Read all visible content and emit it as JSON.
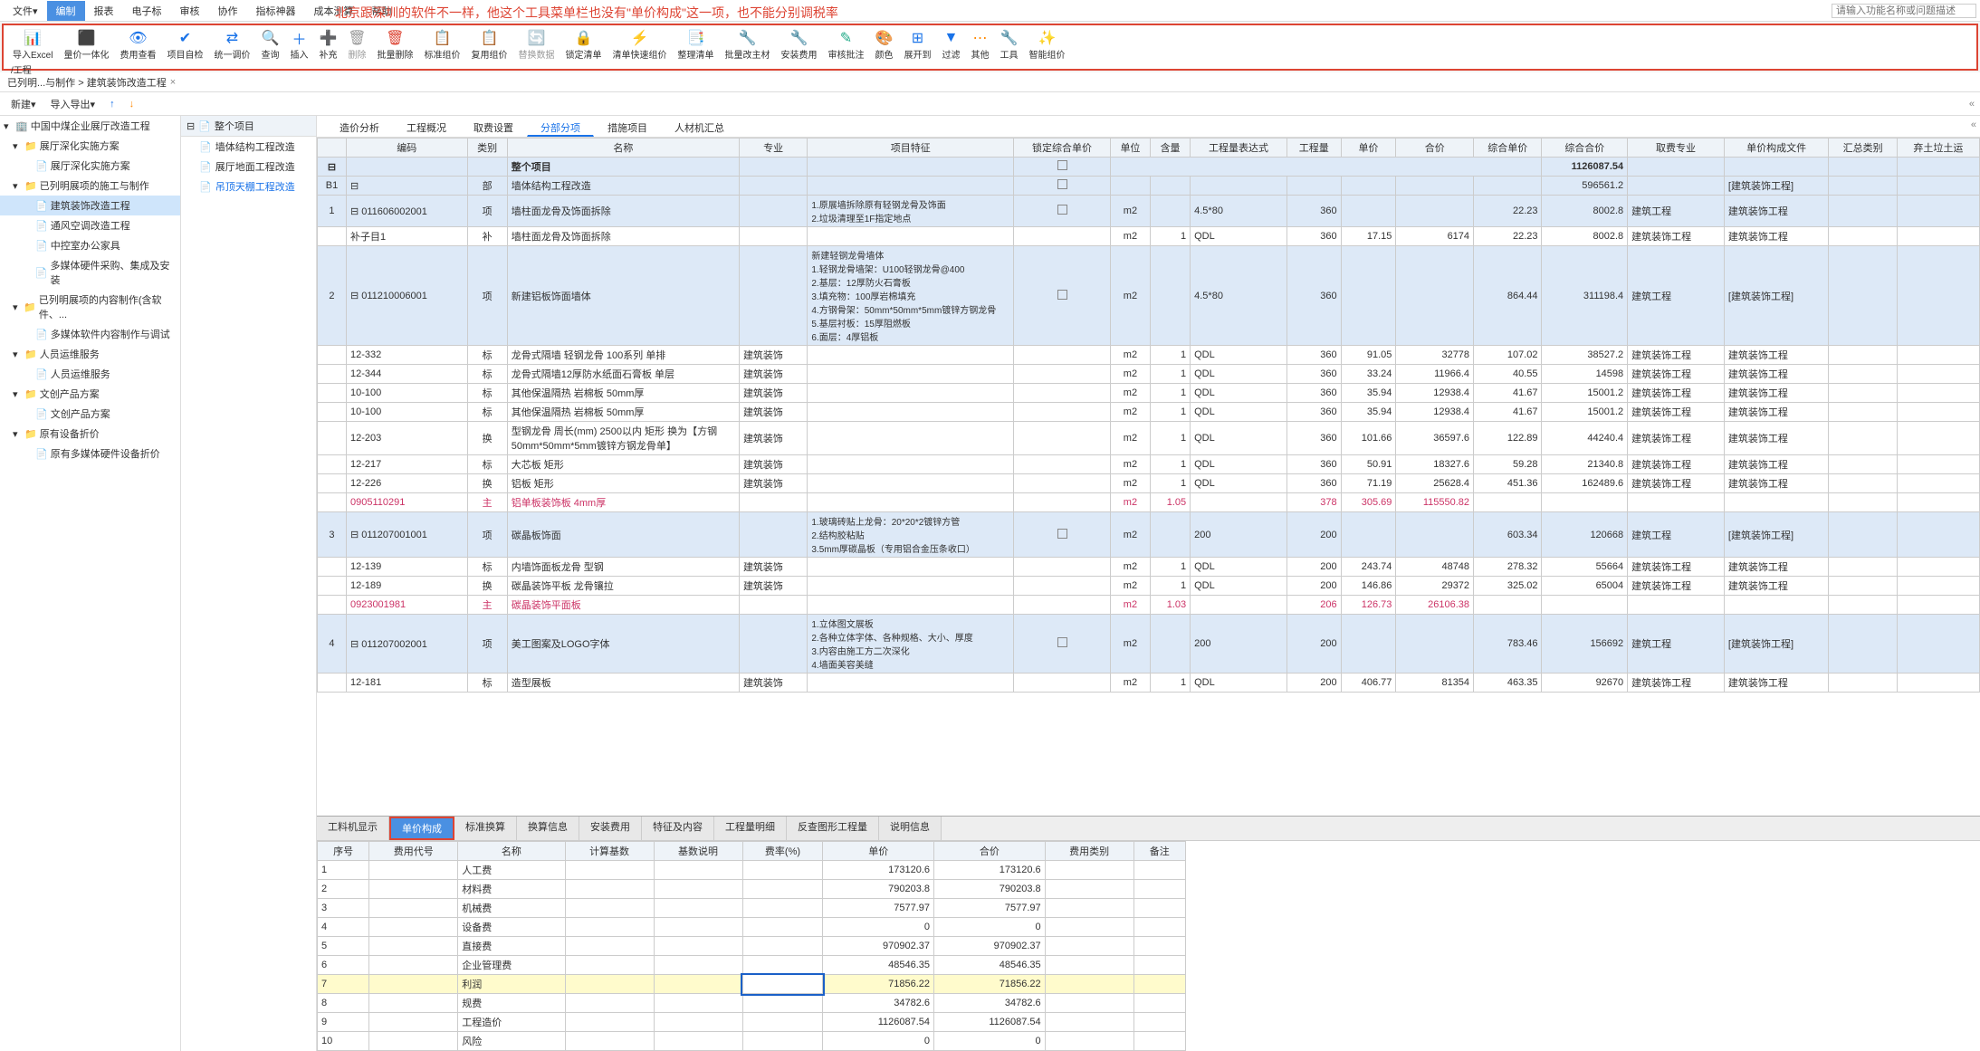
{
  "menu": {
    "items": [
      "文件▾",
      "编制",
      "报表",
      "电子标",
      "审核",
      "协作",
      "指标神器",
      "成本测算",
      "帮助"
    ],
    "active_index": 1,
    "search_placeholder": "请输入功能名称或问题描述"
  },
  "annotation": "北京跟深圳的软件不一样，他这个工具菜单栏也没有\"单价构成\"这一项，也不能分别调税率",
  "toolbar": {
    "items": [
      "导入Excel",
      "量价一体化",
      "费用查看",
      "项目自检",
      "统一调价",
      "查询",
      "插入",
      "补充",
      "删除",
      "批量删除",
      "标准组价",
      "复用组价",
      "替换数据",
      "锁定清单",
      "清单快速组价",
      "整理清单",
      "批量改主材",
      "安装费用",
      "审核批注",
      "颜色",
      "展开到",
      "过滤",
      "其他",
      "工具",
      "智能组价"
    ],
    "sub": "/工程"
  },
  "breadcrumb": {
    "path": "已列明...与制作 > 建筑装饰改造工程",
    "close": "×"
  },
  "doc_tabs": {
    "items": [
      "造价分析",
      "工程概况",
      "取费设置",
      "分部分项",
      "措施项目",
      "人材机汇总"
    ],
    "active_index": 3
  },
  "actions": {
    "new": "新建▾",
    "export": "导入导出▾"
  },
  "left_tree": {
    "root": "中国中煤企业展厅改造工程",
    "items": [
      {
        "t": "展厅深化实施方案",
        "lvl": 1,
        "caret": "▾"
      },
      {
        "t": "展厅深化实施方案",
        "lvl": 2,
        "caret": ""
      },
      {
        "t": "已列明展项的施工与制作",
        "lvl": 1,
        "caret": "▾"
      },
      {
        "t": "建筑装饰改造工程",
        "lvl": 2,
        "caret": "",
        "sel": true
      },
      {
        "t": "通风空调改造工程",
        "lvl": 2,
        "caret": ""
      },
      {
        "t": "中控室办公家具",
        "lvl": 2,
        "caret": ""
      },
      {
        "t": "多媒体硬件采购、集成及安装",
        "lvl": 2,
        "caret": ""
      },
      {
        "t": "已列明展项的内容制作(含软件、...",
        "lvl": 1,
        "caret": "▾"
      },
      {
        "t": "多媒体软件内容制作与调试",
        "lvl": 2,
        "caret": ""
      },
      {
        "t": "人员运维服务",
        "lvl": 1,
        "caret": "▾"
      },
      {
        "t": "人员运维服务",
        "lvl": 2,
        "caret": ""
      },
      {
        "t": "文创产品方案",
        "lvl": 1,
        "caret": "▾"
      },
      {
        "t": "文创产品方案",
        "lvl": 2,
        "caret": ""
      },
      {
        "t": "原有设备折价",
        "lvl": 1,
        "caret": "▾"
      },
      {
        "t": "原有多媒体硬件设备折价",
        "lvl": 2,
        "caret": ""
      }
    ]
  },
  "mid_tree": {
    "header": "整个项目",
    "items": [
      "墙体结构工程改造",
      "展厅地面工程改造",
      "吊顶天棚工程改造"
    ],
    "sel_index": 2
  },
  "grid": {
    "headers": [
      "",
      "编码",
      "类别",
      "名称",
      "专业",
      "项目特征",
      "锁定综合单价",
      "单位",
      "含量",
      "工程量表达式",
      "工程量",
      "单价",
      "合价",
      "综合单价",
      "综合合价",
      "取费专业",
      "单价构成文件",
      "汇总类别",
      "弃土垃土运"
    ],
    "total_label": "整个项目",
    "total_value": "1126087.54",
    "rows": [
      {
        "idx": "B1",
        "cls": "row-blue",
        "code": "",
        "cat": "部",
        "name": "墙体结构工程改造",
        "spec": "",
        "feat": "",
        "unit": "",
        "qty": "",
        "expr": "",
        "amt": "",
        "up": "",
        "hp": "",
        "cup": "",
        "chp": "596561.2",
        "fee": "",
        "file": "[建筑装饰工程]"
      },
      {
        "idx": "1",
        "cls": "row-blue",
        "code": "011606002001",
        "cat": "项",
        "name": "墙柱面龙骨及饰面拆除",
        "spec": "",
        "feat": "1.原展墙拆除原有轻钢龙骨及饰面\n2.垃圾清理至1F指定地点",
        "unit": "m2",
        "qty": "",
        "expr": "4.5*80",
        "amt": "360",
        "up": "",
        "hp": "",
        "cup": "22.23",
        "chp": "8002.8",
        "fee": "建筑工程",
        "file": "建筑装饰工程"
      },
      {
        "idx": "",
        "cls": "",
        "code": "补子目1",
        "cat": "补",
        "name": "墙柱面龙骨及饰面拆除",
        "spec": "",
        "feat": "",
        "unit": "m2",
        "qty": "1",
        "expr": "QDL",
        "amt": "360",
        "up": "17.15",
        "hp": "6174",
        "cup": "22.23",
        "chp": "8002.8",
        "fee": "建筑装饰工程",
        "file": "建筑装饰工程"
      },
      {
        "idx": "2",
        "cls": "row-blue",
        "code": "011210006001",
        "cat": "项",
        "name": "新建铝板饰面墙体",
        "spec": "",
        "feat": "新建轻钢龙骨墙体\n1.轻钢龙骨墙架：U100轻钢龙骨@400\n2.基层：12厚防火石膏板\n3.填充物：100厚岩棉填充\n4.方钢骨架：50mm*50mm*5mm镀锌方钢龙骨\n5.基层衬板：15厚阻燃板\n6.面层：4厚铝板",
        "unit": "m2",
        "qty": "",
        "expr": "4.5*80",
        "amt": "360",
        "up": "",
        "hp": "",
        "cup": "864.44",
        "chp": "311198.4",
        "fee": "建筑工程",
        "file": "[建筑装饰工程]"
      },
      {
        "idx": "",
        "cls": "",
        "code": "12-332",
        "cat": "标",
        "name": "龙骨式隔墙 轻钢龙骨 100系列 单排",
        "spec": "建筑装饰",
        "feat": "",
        "unit": "m2",
        "qty": "1",
        "expr": "QDL",
        "amt": "360",
        "up": "91.05",
        "hp": "32778",
        "cup": "107.02",
        "chp": "38527.2",
        "fee": "建筑装饰工程",
        "file": "建筑装饰工程"
      },
      {
        "idx": "",
        "cls": "",
        "code": "12-344",
        "cat": "标",
        "name": "龙骨式隔墙12厚防水纸面石膏板 单层",
        "spec": "建筑装饰",
        "feat": "",
        "unit": "m2",
        "qty": "1",
        "expr": "QDL",
        "amt": "360",
        "up": "33.24",
        "hp": "11966.4",
        "cup": "40.55",
        "chp": "14598",
        "fee": "建筑装饰工程",
        "file": "建筑装饰工程"
      },
      {
        "idx": "",
        "cls": "",
        "code": "10-100",
        "cat": "标",
        "name": "其他保温隔热 岩棉板 50mm厚",
        "spec": "建筑装饰",
        "feat": "",
        "unit": "m2",
        "qty": "1",
        "expr": "QDL",
        "amt": "360",
        "up": "35.94",
        "hp": "12938.4",
        "cup": "41.67",
        "chp": "15001.2",
        "fee": "建筑装饰工程",
        "file": "建筑装饰工程"
      },
      {
        "idx": "",
        "cls": "",
        "code": "10-100",
        "cat": "标",
        "name": "其他保温隔热 岩棉板 50mm厚",
        "spec": "建筑装饰",
        "feat": "",
        "unit": "m2",
        "qty": "1",
        "expr": "QDL",
        "amt": "360",
        "up": "35.94",
        "hp": "12938.4",
        "cup": "41.67",
        "chp": "15001.2",
        "fee": "建筑装饰工程",
        "file": "建筑装饰工程"
      },
      {
        "idx": "",
        "cls": "",
        "code": "12-203",
        "cat": "换",
        "name": "型钢龙骨 周长(mm) 2500以内 矩形 换为【方钢50mm*50mm*5mm镀锌方钢龙骨单】",
        "spec": "建筑装饰",
        "feat": "",
        "unit": "m2",
        "qty": "1",
        "expr": "QDL",
        "amt": "360",
        "up": "101.66",
        "hp": "36597.6",
        "cup": "122.89",
        "chp": "44240.4",
        "fee": "建筑装饰工程",
        "file": "建筑装饰工程"
      },
      {
        "idx": "",
        "cls": "",
        "code": "12-217",
        "cat": "标",
        "name": "大芯板 矩形",
        "spec": "建筑装饰",
        "feat": "",
        "unit": "m2",
        "qty": "1",
        "expr": "QDL",
        "amt": "360",
        "up": "50.91",
        "hp": "18327.6",
        "cup": "59.28",
        "chp": "21340.8",
        "fee": "建筑装饰工程",
        "file": "建筑装饰工程"
      },
      {
        "idx": "",
        "cls": "",
        "code": "12-226",
        "cat": "换",
        "name": "铝板 矩形",
        "spec": "建筑装饰",
        "feat": "",
        "unit": "m2",
        "qty": "1",
        "expr": "QDL",
        "amt": "360",
        "up": "71.19",
        "hp": "25628.4",
        "cup": "451.36",
        "chp": "162489.6",
        "fee": "建筑装饰工程",
        "file": "建筑装饰工程"
      },
      {
        "idx": "",
        "cls": "row-pink",
        "code": "0905110291",
        "cat": "主",
        "name": "铝单板装饰板 4mm厚",
        "spec": "",
        "feat": "",
        "unit": "m2",
        "qty": "1.05",
        "expr": "",
        "amt": "378",
        "up": "305.69",
        "hp": "115550.82",
        "cup": "",
        "chp": "",
        "fee": "",
        "file": ""
      },
      {
        "idx": "3",
        "cls": "row-blue",
        "code": "011207001001",
        "cat": "项",
        "name": "碳晶板饰面",
        "spec": "",
        "feat": "1.玻璃砖贴上龙骨：20*20*2镀锌方管\n2.结构胶粘贴\n3.5mm厚碳晶板（专用铝合金压条收口）",
        "unit": "m2",
        "qty": "",
        "expr": "200",
        "amt": "200",
        "up": "",
        "hp": "",
        "cup": "603.34",
        "chp": "120668",
        "fee": "建筑工程",
        "file": "[建筑装饰工程]"
      },
      {
        "idx": "",
        "cls": "",
        "code": "12-139",
        "cat": "标",
        "name": "内墙饰面板龙骨 型钢",
        "spec": "建筑装饰",
        "feat": "",
        "unit": "m2",
        "qty": "1",
        "expr": "QDL",
        "amt": "200",
        "up": "243.74",
        "hp": "48748",
        "cup": "278.32",
        "chp": "55664",
        "fee": "建筑装饰工程",
        "file": "建筑装饰工程"
      },
      {
        "idx": "",
        "cls": "",
        "code": "12-189",
        "cat": "换",
        "name": "碳晶装饰平板 龙骨镶拉",
        "spec": "建筑装饰",
        "feat": "",
        "unit": "m2",
        "qty": "1",
        "expr": "QDL",
        "amt": "200",
        "up": "146.86",
        "hp": "29372",
        "cup": "325.02",
        "chp": "65004",
        "fee": "建筑装饰工程",
        "file": "建筑装饰工程"
      },
      {
        "idx": "",
        "cls": "row-pink",
        "code": "0923001981",
        "cat": "主",
        "name": "碳晶装饰平面板",
        "spec": "",
        "feat": "",
        "unit": "m2",
        "qty": "1.03",
        "expr": "",
        "amt": "206",
        "up": "126.73",
        "hp": "26106.38",
        "cup": "",
        "chp": "",
        "fee": "",
        "file": ""
      },
      {
        "idx": "4",
        "cls": "row-blue",
        "code": "011207002001",
        "cat": "项",
        "name": "美工图案及LOGO字体",
        "spec": "",
        "feat": "1.立体图文展板\n2.各种立体字体、各种规格、大小、厚度\n3.内容由施工方二次深化\n4.墙面美容美缝",
        "unit": "m2",
        "qty": "",
        "expr": "200",
        "amt": "200",
        "up": "",
        "hp": "",
        "cup": "783.46",
        "chp": "156692",
        "fee": "建筑工程",
        "file": "[建筑装饰工程]"
      },
      {
        "idx": "",
        "cls": "",
        "code": "12-181",
        "cat": "标",
        "name": "造型展板",
        "spec": "建筑装饰",
        "feat": "",
        "unit": "m2",
        "qty": "1",
        "expr": "QDL",
        "amt": "200",
        "up": "406.77",
        "hp": "81354",
        "cup": "463.35",
        "chp": "92670",
        "fee": "建筑装饰工程",
        "file": "建筑装饰工程"
      }
    ]
  },
  "lower": {
    "tabs": [
      "工料机显示",
      "单价构成",
      "标准换算",
      "换算信息",
      "安装费用",
      "特征及内容",
      "工程量明细",
      "反查图形工程量",
      "说明信息"
    ],
    "active_index": 1,
    "headers": [
      "序号",
      "费用代号",
      "名称",
      "计算基数",
      "基数说明",
      "费率(%)",
      "单价",
      "合价",
      "费用类别",
      "备注"
    ],
    "rows": [
      {
        "n": "1",
        "name": "人工费",
        "rate": "",
        "up": "173120.6",
        "hp": "173120.6"
      },
      {
        "n": "2",
        "name": "材料费",
        "rate": "",
        "up": "790203.8",
        "hp": "790203.8"
      },
      {
        "n": "3",
        "name": "机械费",
        "rate": "",
        "up": "7577.97",
        "hp": "7577.97"
      },
      {
        "n": "4",
        "name": "设备费",
        "rate": "",
        "up": "0",
        "hp": "0"
      },
      {
        "n": "5",
        "name": "直接费",
        "rate": "",
        "up": "970902.37",
        "hp": "970902.37"
      },
      {
        "n": "6",
        "name": "企业管理费",
        "rate": "",
        "up": "48546.35",
        "hp": "48546.35"
      },
      {
        "n": "7",
        "name": "利润",
        "rate": "",
        "up": "71856.22",
        "hp": "71856.22",
        "sel": true
      },
      {
        "n": "8",
        "name": "规费",
        "rate": "",
        "up": "34782.6",
        "hp": "34782.6"
      },
      {
        "n": "9",
        "name": "工程造价",
        "rate": "",
        "up": "1126087.54",
        "hp": "1126087.54"
      },
      {
        "n": "10",
        "name": "风险",
        "rate": "",
        "up": "0",
        "hp": "0"
      }
    ]
  }
}
